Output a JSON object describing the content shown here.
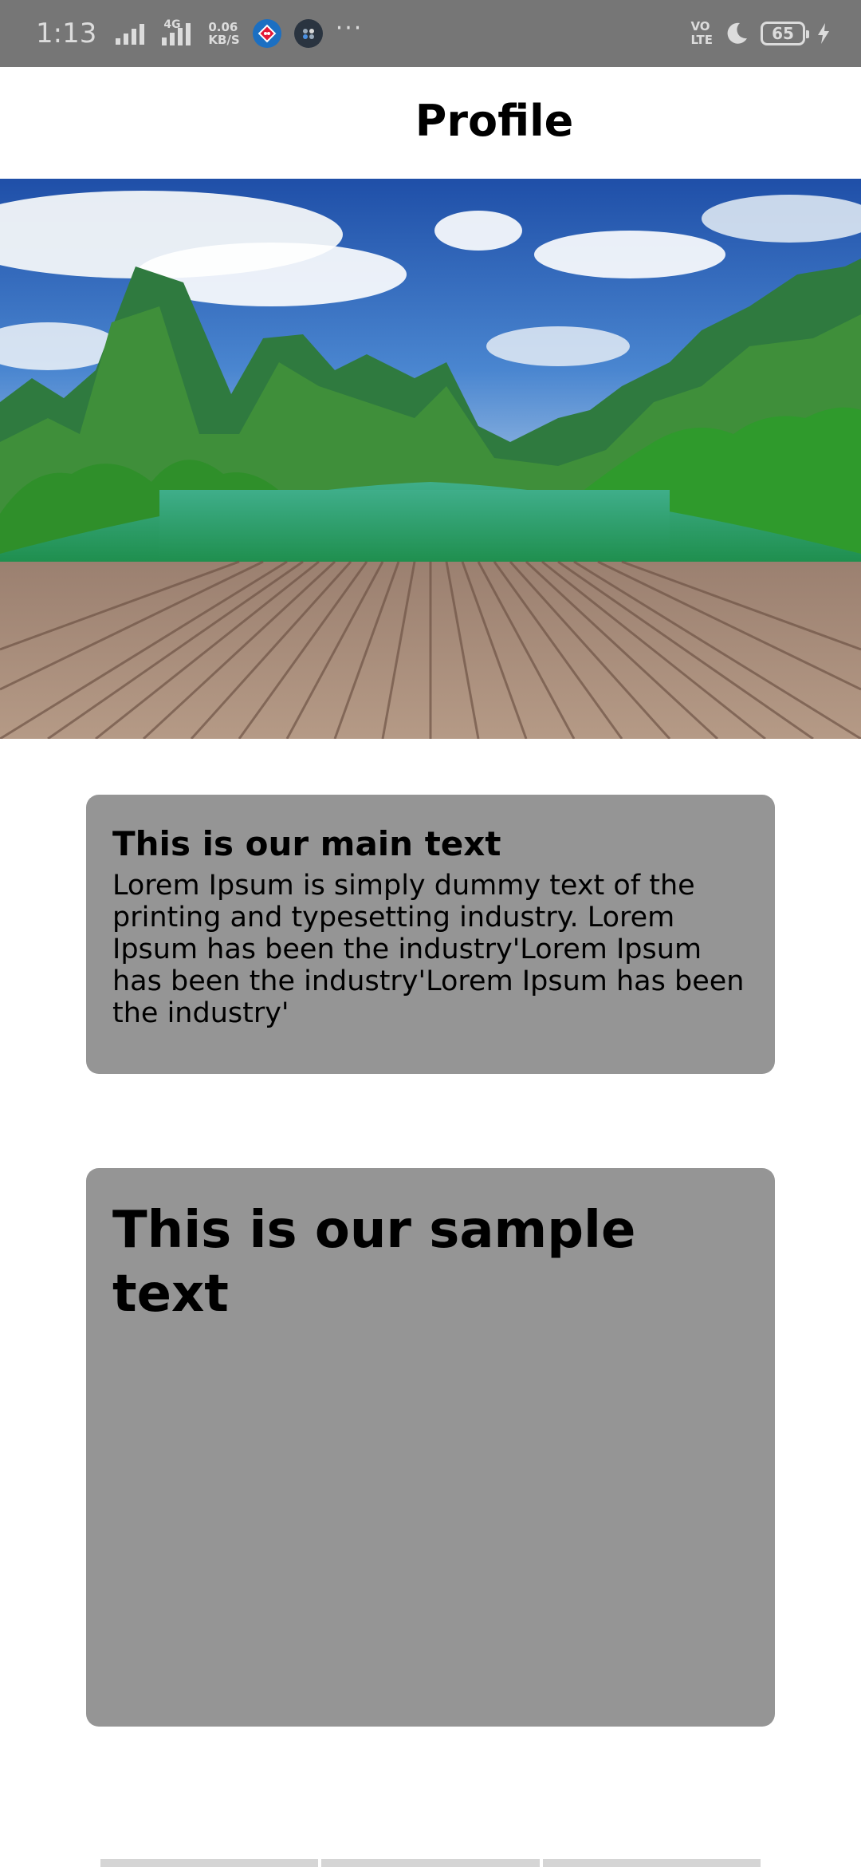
{
  "status_bar": {
    "time": "1:13",
    "network_type": "4G",
    "net_speed_value": "0.06",
    "net_speed_unit": "KB/S",
    "more_indicator": "···",
    "volte_line1": "VO",
    "volte_line2": "LTE",
    "battery_level": "65",
    "icons": [
      "signal-icon",
      "signal-4g-icon",
      "dominos-app-icon",
      "app-notification-icon",
      "moon-icon",
      "charging-icon"
    ]
  },
  "header": {
    "title": "Profile"
  },
  "hero": {
    "image_subject": "mountain-river-landscape-with-wooden-deck"
  },
  "cards": {
    "main": {
      "title": "This is our main text",
      "body": "Lorem Ipsum is simply dummy text of the printing and typesetting industry. Lorem Ipsum has been the industry'Lorem Ipsum has been the industry'Lorem Ipsum has been the industry'"
    },
    "sample": {
      "title": "This is our sample text"
    }
  },
  "colors": {
    "status_bar_bg": "#767676",
    "card_bg": "#959595",
    "page_bg": "#ffffff",
    "text": "#000000"
  }
}
